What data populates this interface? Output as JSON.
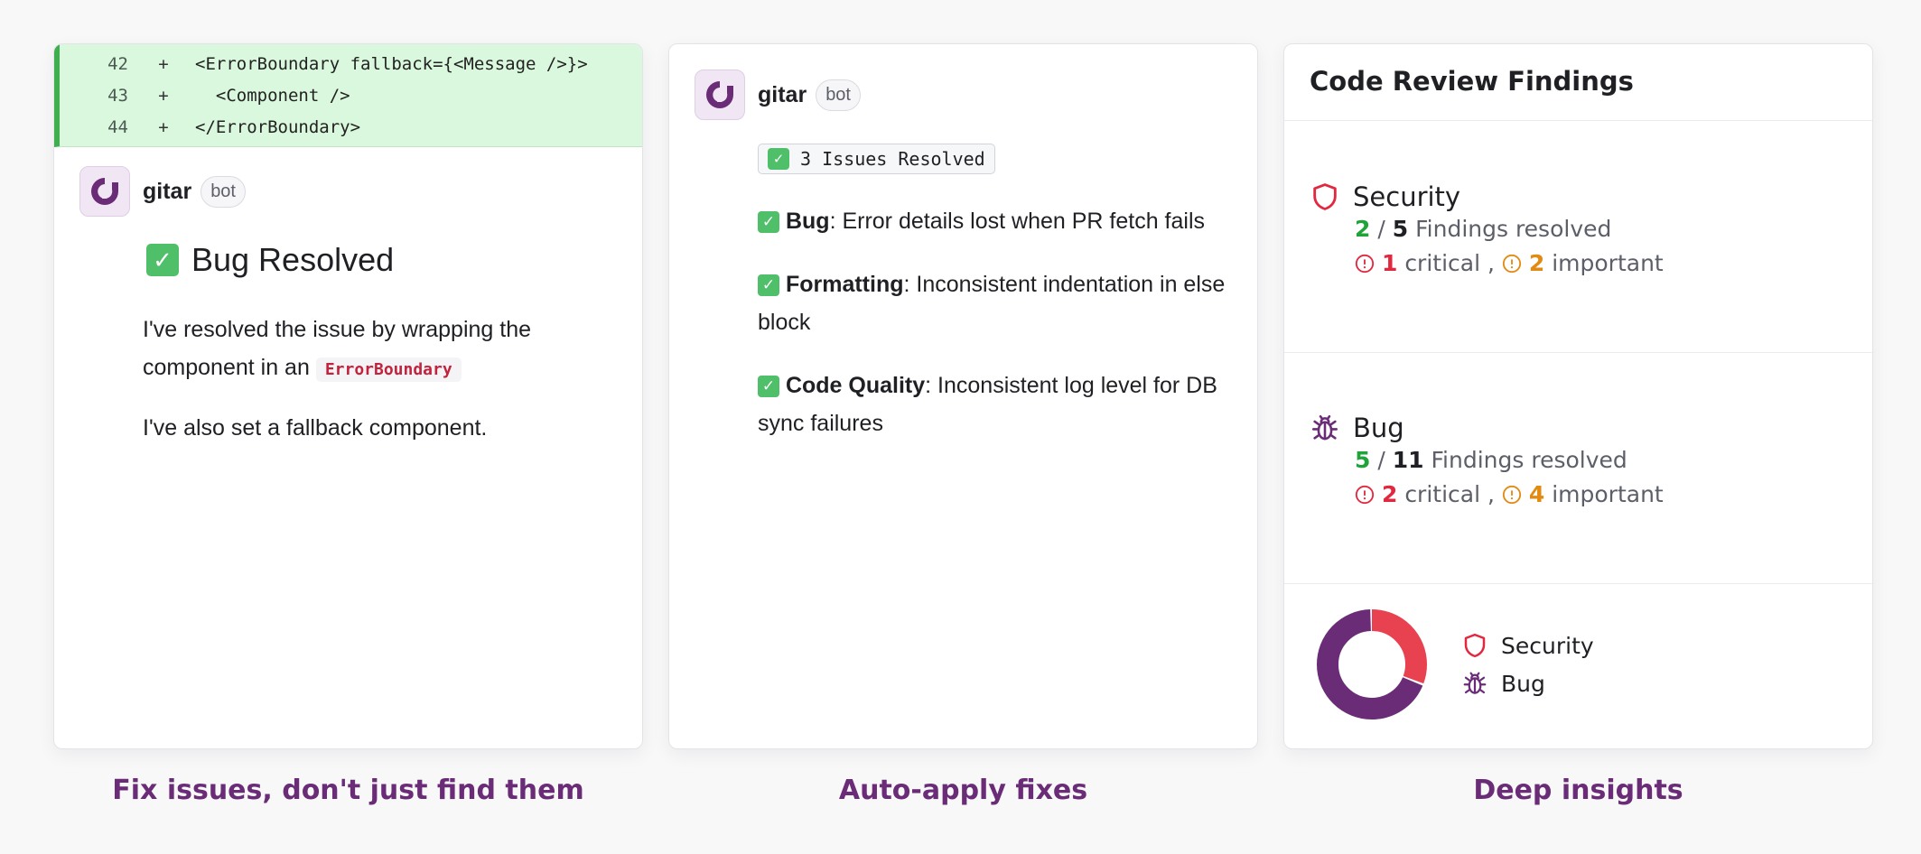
{
  "card1": {
    "diff_lines": [
      {
        "num": "42",
        "sign": "+",
        "code": "<ErrorBoundary fallback={<Message />}>"
      },
      {
        "num": "43",
        "sign": "+",
        "code": "  <Component />"
      },
      {
        "num": "44",
        "sign": "+",
        "code": "</ErrorBoundary>"
      }
    ],
    "bot_name": "gitar",
    "bot_badge": "bot",
    "title": "Bug Resolved",
    "para1_text": "I've resolved the issue by wrapping the component in an",
    "para1_code": "ErrorBoundary",
    "para2": "I've also set a fallback component."
  },
  "card2": {
    "bot_name": "gitar",
    "bot_badge": "bot",
    "chip": "3 Issues Resolved",
    "issues": [
      {
        "label": "Bug",
        "text": ": Error details lost when PR fetch fails"
      },
      {
        "label": "Formatting",
        "text": ": Inconsistent indentation in else block"
      },
      {
        "label": "Code Quality",
        "text": ": Inconsistent log level for DB sync failures"
      }
    ]
  },
  "card3": {
    "title": "Code Review Findings",
    "sections": [
      {
        "name": "Security",
        "icon": "shield-icon",
        "resolved": "2",
        "total": "5",
        "resolved_label": "Findings resolved",
        "critical": "1",
        "critical_label": "critical",
        "important": "2",
        "important_label": "important"
      },
      {
        "name": "Bug",
        "icon": "bug-icon",
        "resolved": "5",
        "total": "11",
        "resolved_label": "Findings resolved",
        "critical": "2",
        "critical_label": "critical",
        "important": "4",
        "important_label": "important"
      }
    ],
    "legend": [
      {
        "label": "Security",
        "color": "#e8414f"
      },
      {
        "label": "Bug",
        "color": "#6a2c77"
      }
    ]
  },
  "chart_data": {
    "type": "pie",
    "categories": [
      "Security",
      "Bug"
    ],
    "values": [
      5,
      11
    ],
    "colors": [
      "#e8414f",
      "#6a2c77"
    ]
  },
  "captions": [
    "Fix issues, don't just find them",
    "Auto-apply fixes",
    "Deep insights"
  ],
  "colors": {
    "accent": "#6a2c77",
    "success": "#1fa33a",
    "critical": "#e2283f",
    "important": "#e28a12"
  }
}
